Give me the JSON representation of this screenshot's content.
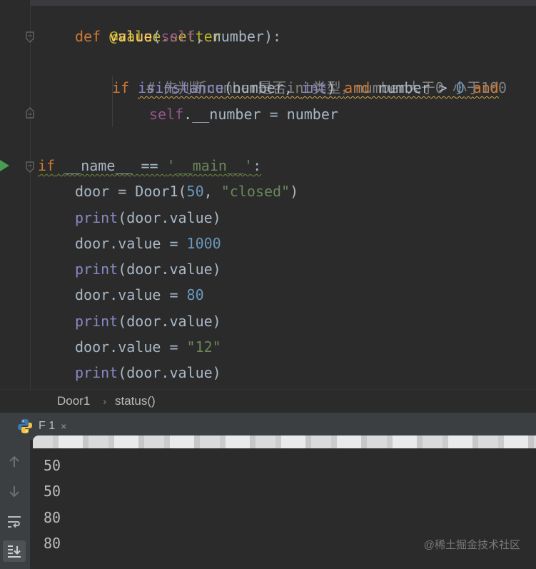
{
  "editor": {
    "lines": [
      {
        "text_decorator": "@value.setter"
      },
      {
        "kw_def": "def",
        "fn_name": "value",
        "p_open": "(",
        "self": "self",
        "p_rest": ", number):"
      },
      {
        "comment": "# 先判断number是否int类型，number大于0 小于100"
      },
      {
        "kw_if": "if",
        "bi_isinstance": "isinstance",
        "args_open": "(number, ",
        "bi_int": "int",
        "args_close": ")",
        "kw_and1": "and",
        "cond": " number > ",
        "num0": "0",
        "kw_and2": "and"
      },
      {
        "self": "self",
        "rest": ".__number = number"
      },
      {
        "kw_if": "if",
        "name_cmp": "__name__ == ",
        "str_main": "'__main__'",
        "colon": ":"
      },
      {
        "pre": "door = Door1(",
        "num": "50",
        "comma": ", ",
        "str": "\"closed\"",
        "post": ")"
      },
      {
        "bi": "print",
        "rest": "(door.value)"
      },
      {
        "pre": "door.value = ",
        "num": "1000"
      },
      {
        "bi": "print",
        "rest": "(door.value)"
      },
      {
        "pre": "door.value = ",
        "num": "80"
      },
      {
        "bi": "print",
        "rest": "(door.value)"
      },
      {
        "pre": "door.value = ",
        "str": "\"12\""
      },
      {
        "bi": "print",
        "rest": "(door.value)"
      }
    ]
  },
  "breadcrumb": {
    "items": [
      "Door1",
      "status()"
    ],
    "separator": "›"
  },
  "run_panel": {
    "tab_label": "F 1",
    "close_glyph": "×",
    "output": [
      "50",
      "50",
      "80",
      "80"
    ],
    "icons": [
      "arrow-up-icon",
      "arrow-down-icon",
      "soft-wrap-icon",
      "scroll-to-end-icon"
    ]
  },
  "watermark": "@稀土掘金技术社区",
  "colors": {
    "background": "#2b2b2b",
    "keyword": "#cc7832",
    "function": "#ffc66d",
    "self": "#94558d",
    "number": "#6897bb",
    "string": "#6a8759",
    "builtin": "#8888c6",
    "comment": "#808080",
    "run_green": "#499c54"
  }
}
